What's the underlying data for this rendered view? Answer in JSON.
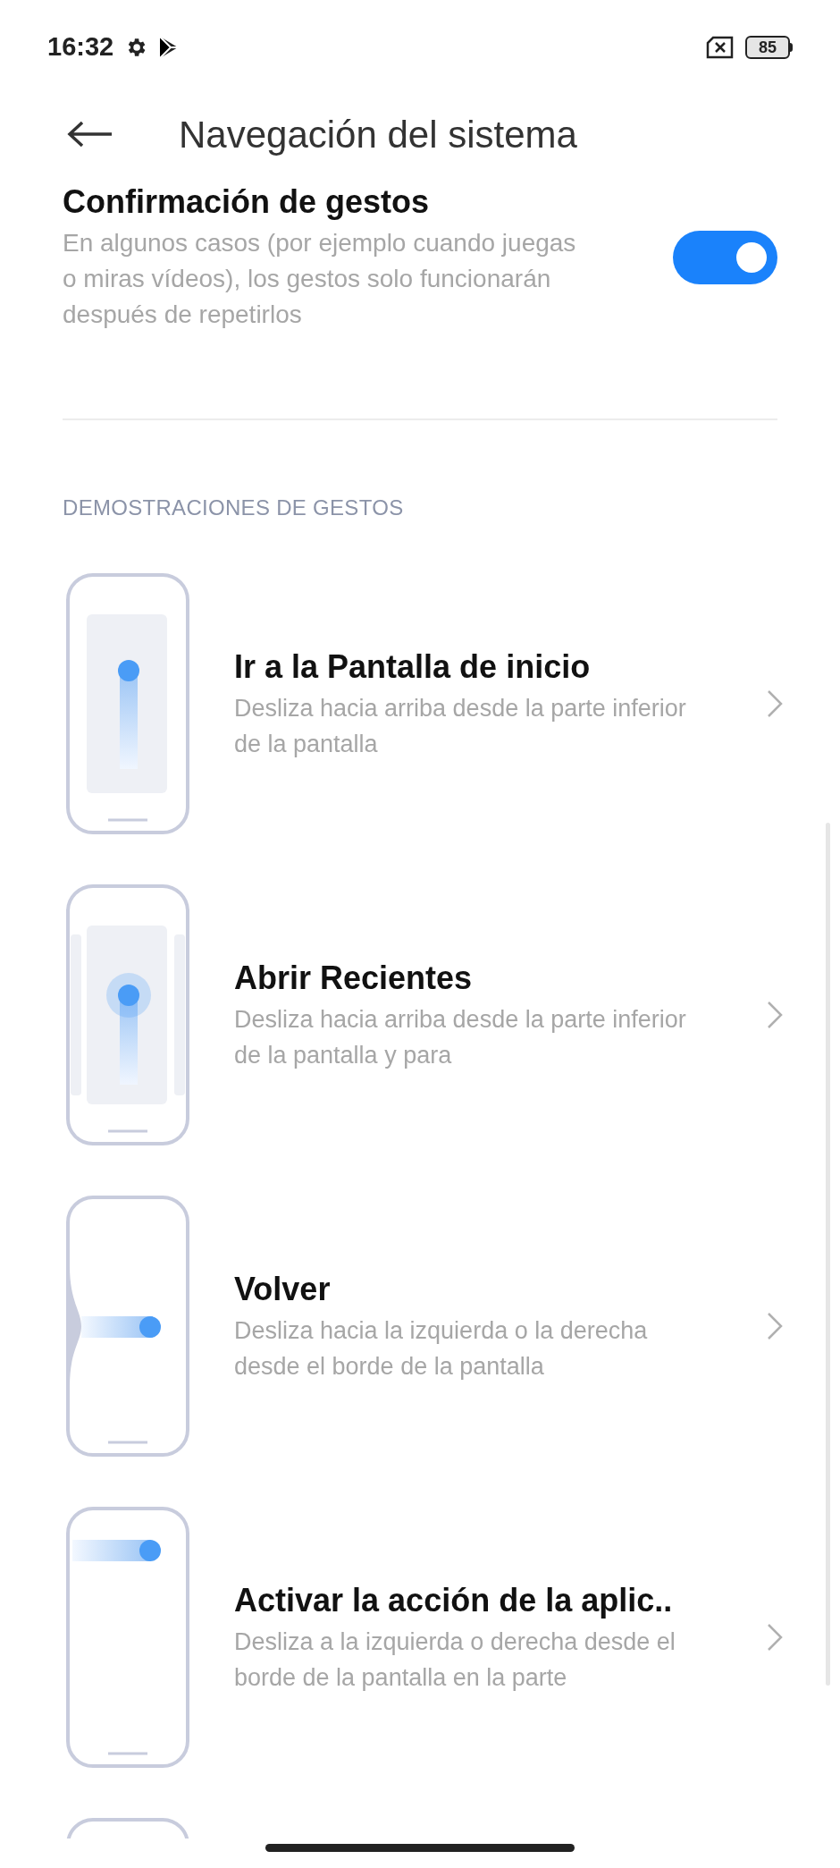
{
  "status_bar": {
    "time": "16:32",
    "battery": "85"
  },
  "header": {
    "title": "Navegación del sistema"
  },
  "confirmation": {
    "title": "Confirmación de gestos",
    "description": "En algunos casos (por ejemplo cuando juegas o miras vídeos), los gestos solo funcionarán después de repetirlos",
    "on": true
  },
  "section_header": "DEMOSTRACIONES DE GESTOS",
  "demos": [
    {
      "kind": "home",
      "title": "Ir a la Pantalla de inicio",
      "description": "Desliza hacia arriba desde la parte inferior de la pantalla"
    },
    {
      "kind": "recents",
      "title": "Abrir Recientes",
      "description": "Desliza hacia arriba desde la parte inferior de la pantalla y para"
    },
    {
      "kind": "back",
      "title": "Volver",
      "description": "Desliza hacia la izquierda o la derecha desde el borde de la pantalla"
    },
    {
      "kind": "app_action",
      "title": "Activar la acción de la aplic..",
      "description": "Desliza a la izquierda o derecha desde el borde de la pantalla en la parte"
    },
    {
      "kind": "partial"
    }
  ]
}
